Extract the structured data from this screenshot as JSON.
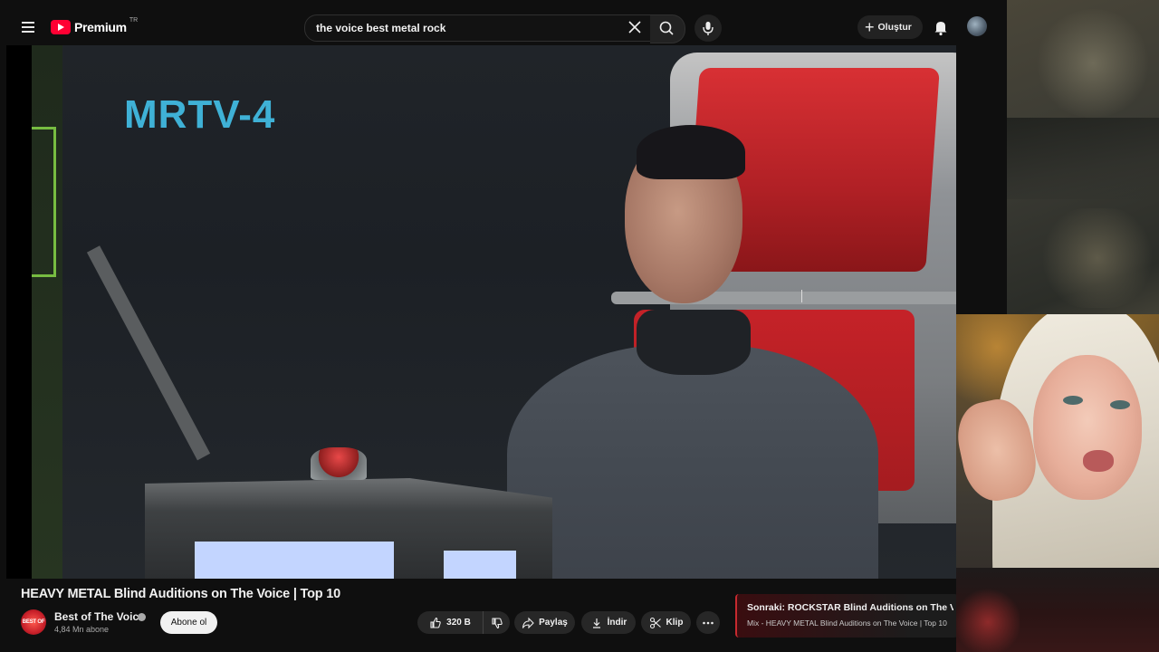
{
  "topbar": {
    "logo_text": "Premium",
    "logo_country": "TR",
    "search_value": "the voice best metal rock",
    "create_label": "Oluştur"
  },
  "video": {
    "overlay_channel": "MRTV-4"
  },
  "meta": {
    "title": "HEAVY METAL Blind Auditions on The Voice | Top 10",
    "channel_name": "Best of The Voice",
    "channel_avatar_text": "BEST OF",
    "subscribers": "4,84 Mn abone",
    "subscribe_label": "Abone ol"
  },
  "actions": {
    "like_count": "320 B",
    "share_label": "Paylaş",
    "download_label": "İndir",
    "clip_label": "Klip"
  },
  "next_up": {
    "heading": "Sonraki: ROCKSTAR Blind Auditions on The Voice ...",
    "subtitle": "Mix - HEAVY METAL Blind Auditions on The Voice | Top 10"
  },
  "colors": {
    "accent_red": "#ff0033",
    "channel_logo": "#3fb1d6",
    "background": "#0f0f0f"
  }
}
